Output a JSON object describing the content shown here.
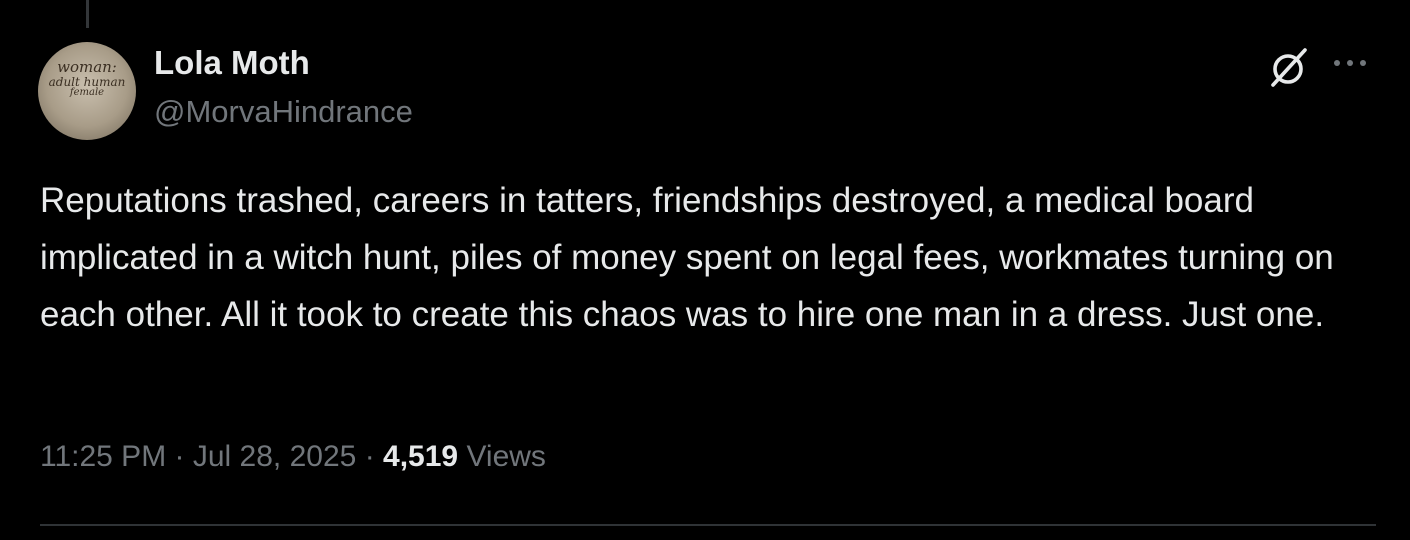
{
  "post": {
    "author": {
      "display_name": "Lola Moth",
      "handle": "@MorvaHindrance",
      "avatar_text": [
        "woman:",
        "adult human",
        "female"
      ]
    },
    "text": "Reputations trashed, careers in tatters, friendships destroyed, a medical board implicated in a witch hunt, piles of money spent on legal fees, workmates turning on each other. All it took to create this chaos was to hire one man in a dress. Just one.",
    "time": "11:25 PM",
    "separator": "·",
    "date": "Jul 28, 2025",
    "views_count": "4,519",
    "views_label": "Views"
  },
  "icons": {
    "grok": "grok-icon",
    "more": "more-icon"
  },
  "colors": {
    "background": "#000000",
    "primary_text": "#e7e9ea",
    "secondary_text": "#71767b",
    "divider": "#2f3336"
  }
}
